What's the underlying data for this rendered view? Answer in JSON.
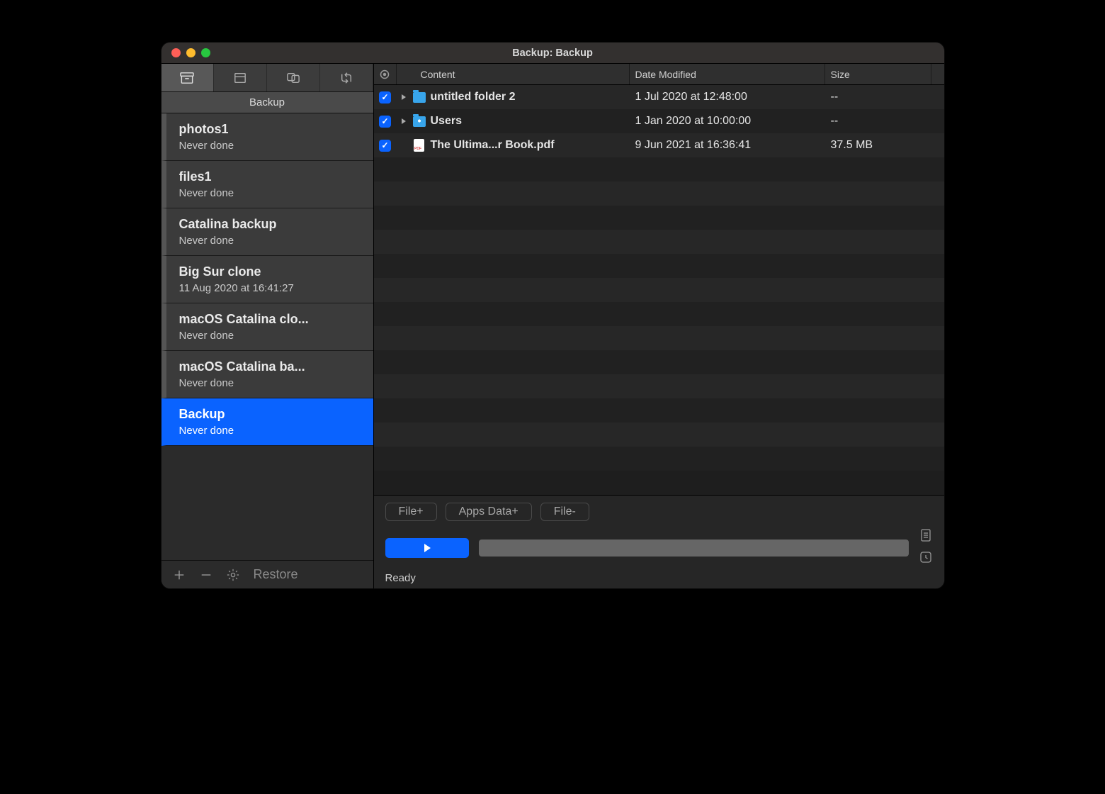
{
  "window": {
    "title": "Backup: Backup"
  },
  "sidebar": {
    "header_label": "Backup",
    "tasks": [
      {
        "name": "photos1",
        "status": "Never done",
        "selected": false
      },
      {
        "name": "files1",
        "status": "Never done",
        "selected": false
      },
      {
        "name": "Catalina backup",
        "status": "Never done",
        "selected": false
      },
      {
        "name": "Big Sur clone",
        "status": "11 Aug 2020 at 16:41:27",
        "selected": false
      },
      {
        "name": "macOS Catalina clo...",
        "status": "Never done",
        "selected": false
      },
      {
        "name": "macOS Catalina ba...",
        "status": "Never done",
        "selected": false
      },
      {
        "name": "Backup",
        "status": "Never done",
        "selected": true
      }
    ],
    "footer": {
      "restore_label": "Restore"
    }
  },
  "columns": {
    "content": "Content",
    "date": "Date Modified",
    "size": "Size"
  },
  "rows": [
    {
      "checked": true,
      "expandable": true,
      "icon": "folder",
      "name": "untitled folder 2",
      "date": "1 Jul 2020 at 12:48:00",
      "size": "--"
    },
    {
      "checked": true,
      "expandable": true,
      "icon": "folder-users",
      "name": "Users",
      "date": "1 Jan 2020 at 10:00:00",
      "size": "--"
    },
    {
      "checked": true,
      "expandable": false,
      "icon": "file",
      "name": "The Ultima...r Book.pdf",
      "date": "9 Jun 2021 at 16:36:41",
      "size": "37.5 MB"
    }
  ],
  "bottom": {
    "file_add": "File+",
    "apps_data": "Apps Data+",
    "file_remove": "File-",
    "status": "Ready"
  }
}
